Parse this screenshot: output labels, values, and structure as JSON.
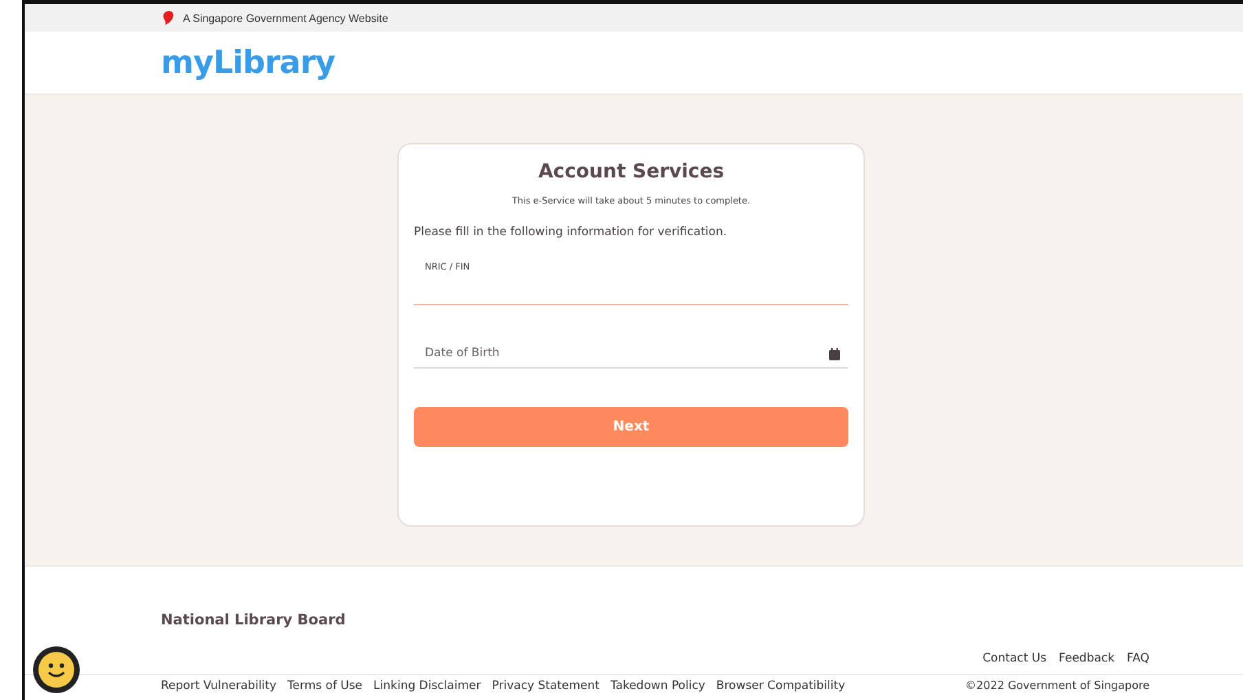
{
  "gov_bar": {
    "text": "A Singapore Government Agency Website"
  },
  "header": {
    "logo": "myLibrary"
  },
  "card": {
    "title": "Account Services",
    "note": "This e-Service will take about 5 minutes to complete.",
    "instruction": "Please fill in the following information for verification.",
    "fields": [
      {
        "kind": "text",
        "label": "NRIC / FIN"
      },
      {
        "kind": "date",
        "placeholder": "Date of Birth"
      }
    ],
    "button": "Next"
  },
  "footer": {
    "org": "National Library Board",
    "top_links": [
      "Contact Us",
      "Feedback",
      "FAQ"
    ],
    "bottom_links": [
      "Report Vulnerability",
      "Terms of Use",
      "Linking Disclaimer",
      "Privacy Statement",
      "Takedown Policy",
      "Browser Compatibility"
    ],
    "copyright": "©2022 Government of Singapore"
  }
}
